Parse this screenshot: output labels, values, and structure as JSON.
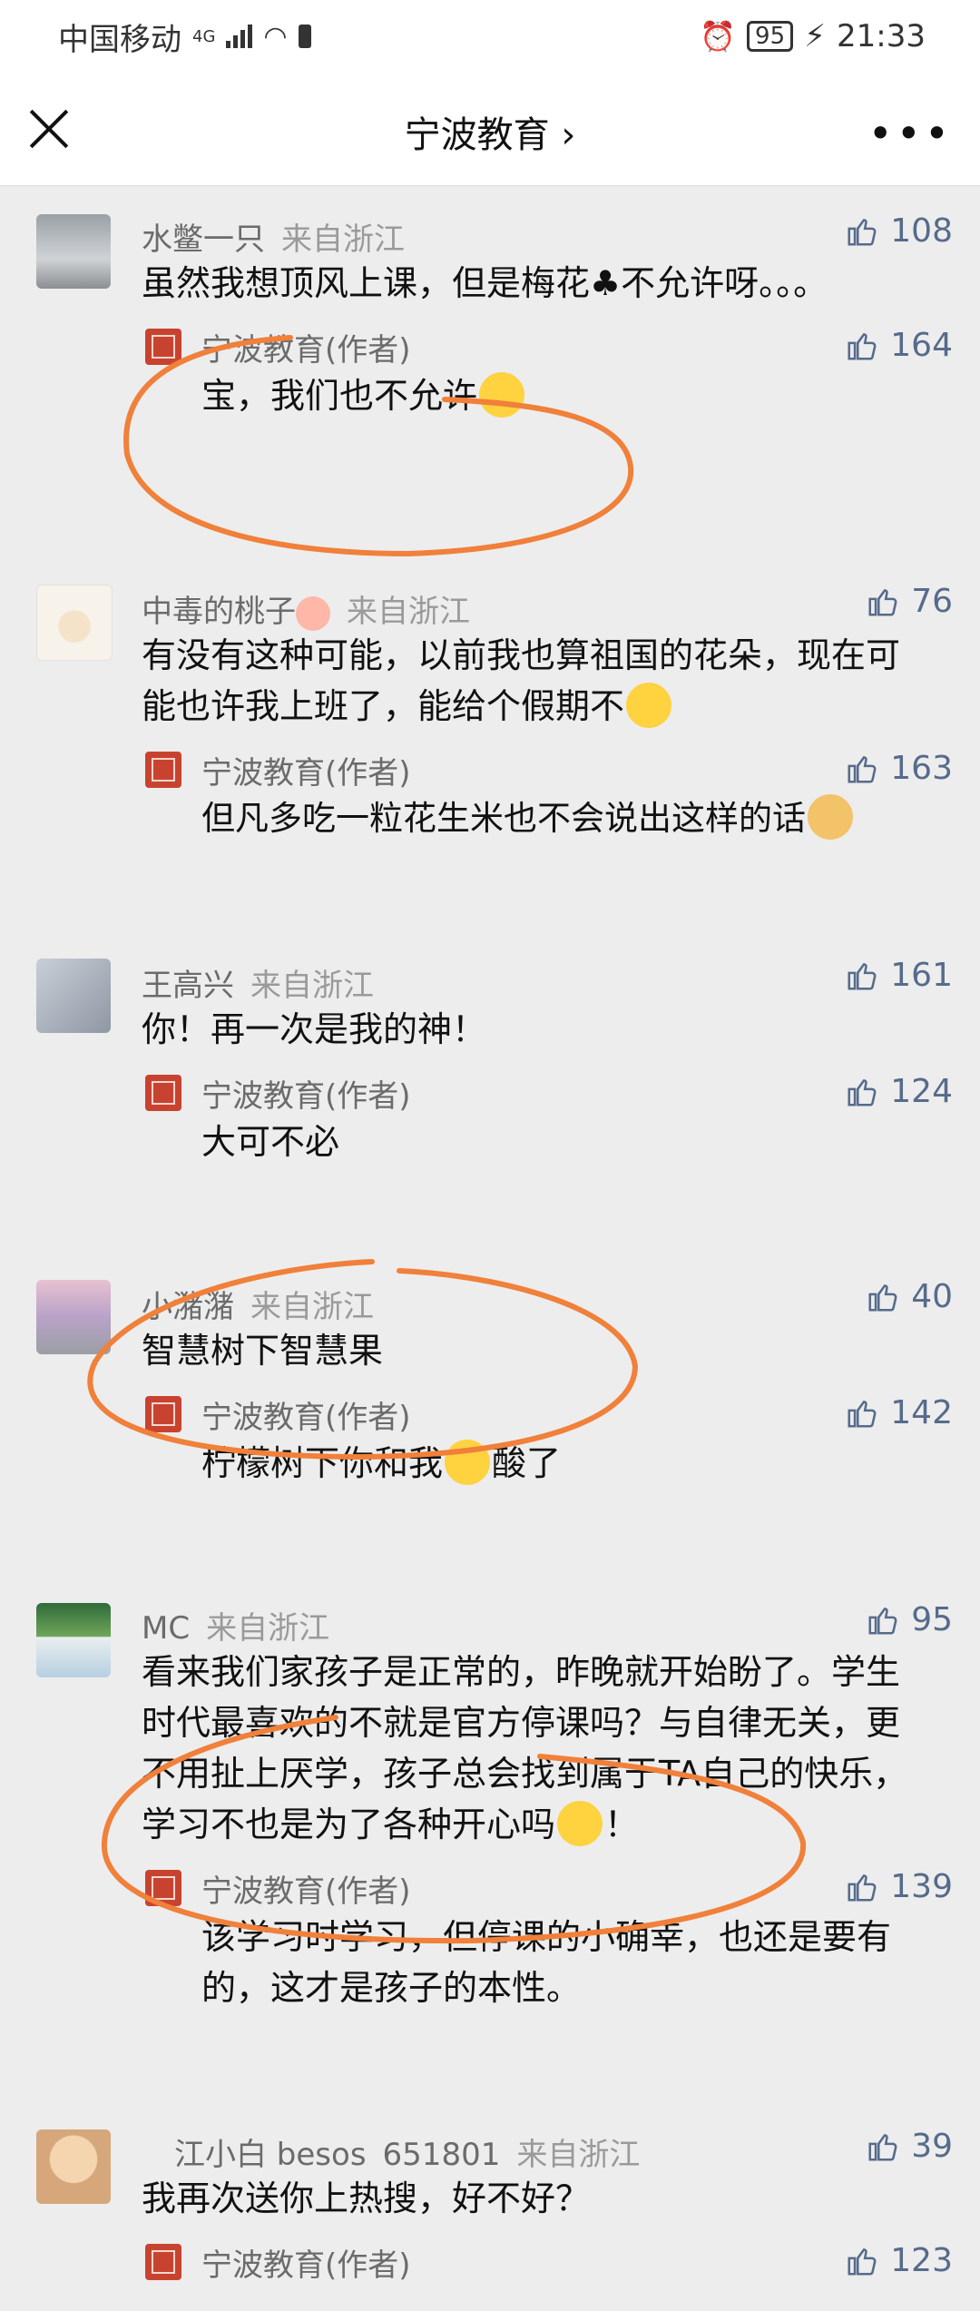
{
  "status": {
    "carrier": "中国移动",
    "net": "4G",
    "battery": "95",
    "time": "21:33"
  },
  "nav": {
    "title": "宁波教育 ›",
    "more": "•••"
  },
  "colors": {
    "accent": "#566b8c",
    "annotation": "#f0803a"
  },
  "comments": [
    {
      "name": "水鳖一只",
      "loc": "来自浙江",
      "likes": "108",
      "text": "虽然我想顶风上课，但是梅花♣不允许呀。。。",
      "reply": {
        "name": "宁波教育(作者)",
        "likes": "164",
        "text": "宝，我们也不允许"
      }
    },
    {
      "name": "中毒的桃子",
      "loc": "来自浙江",
      "likes": "76",
      "text": "有没有这种可能，以前我也算祖国的花朵，现在可能也许我上班了，能给个假期不",
      "reply": {
        "name": "宁波教育(作者)",
        "likes": "163",
        "text": "但凡多吃一粒花生米也不会说出这样的话"
      }
    },
    {
      "name": "王高兴",
      "loc": "来自浙江",
      "likes": "161",
      "text": "你！再一次是我的神！",
      "reply": {
        "name": "宁波教育(作者)",
        "likes": "124",
        "text": "大可不必"
      }
    },
    {
      "name": "小潴潴",
      "loc": "来自浙江",
      "likes": "40",
      "text": "智慧树下智慧果",
      "reply": {
        "name": "宁波教育(作者)",
        "likes": "142",
        "text_a": "柠檬树下你和我",
        "text_b": "酸了"
      }
    },
    {
      "name": "MC",
      "loc": "来自浙江",
      "likes": "95",
      "text": "看来我们家孩子是正常的，昨晚就开始盼了。学生时代最喜欢的不就是官方停课吗？与自律无关，更不用扯上厌学，孩子总会找到属于TA自己的快乐，学习不也是为了各种开心吗",
      "text_end": "！",
      "reply": {
        "name": "宁波教育(作者)",
        "likes": "139",
        "text": "该学习时学习，但停课的小确幸，也还是要有的，这才是孩子的本性。"
      }
    },
    {
      "name": "江小白 besos",
      "id": "651801",
      "loc": "来自浙江",
      "likes": "39",
      "text": "我再次送你上热搜，好不好？",
      "reply": {
        "name": "宁波教育(作者)",
        "likes": "123"
      }
    }
  ]
}
